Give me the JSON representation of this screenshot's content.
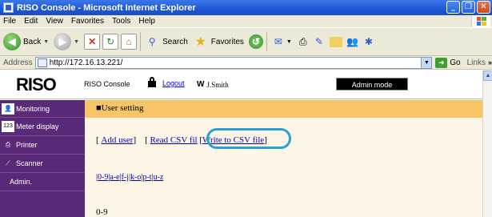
{
  "window": {
    "title": "RISO Console - Microsoft Internet Explorer",
    "buttons": [
      "_",
      "❐",
      "✕"
    ]
  },
  "menu": [
    "File",
    "Edit",
    "View",
    "Favorites",
    "Tools",
    "Help"
  ],
  "toolbar": {
    "back": "Back",
    "search": "Search",
    "favorites": "Favorites"
  },
  "address": {
    "label": "Address",
    "url": "http://172.16.13.221/",
    "go": "Go",
    "links": "Links"
  },
  "header": {
    "logo": "RISO",
    "console": "RISO Console",
    "logout": "Logout",
    "user": "J.Smith",
    "admin_mode": "Admin mode"
  },
  "sidebar": {
    "items": [
      {
        "label": "Monitoring",
        "icon": "monitoring-icon"
      },
      {
        "label": "Meter display",
        "icon": "meter-icon"
      },
      {
        "label": "Printer",
        "icon": "printer-icon"
      },
      {
        "label": "Scanner",
        "icon": "scanner-icon"
      },
      {
        "label": "Admin.",
        "icon": ""
      }
    ]
  },
  "content": {
    "breadcrumb": "■User setting",
    "actions": {
      "add_user": "Add user",
      "read_csv": "Read CSV fil",
      "write_csv": "Write to CSV file"
    },
    "alpha_index": [
      "0-9",
      "a-e",
      "f-j",
      "k-o",
      "p-t",
      "u-z"
    ],
    "section": "0-9"
  }
}
